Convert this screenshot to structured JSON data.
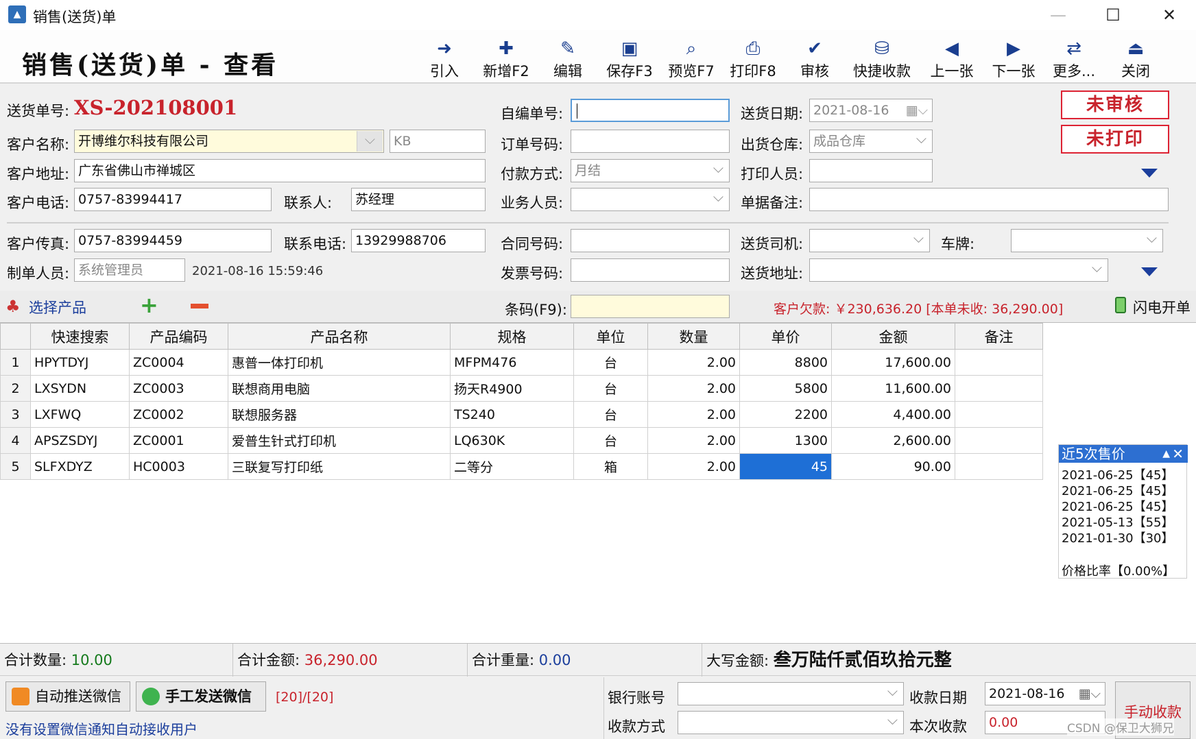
{
  "window": {
    "title": "销售(送货)单"
  },
  "header": {
    "title": "销售(送货)单 - 查看"
  },
  "toolbar": [
    {
      "label": "引入",
      "icon": "➜"
    },
    {
      "label": "新增F2",
      "icon": "✚"
    },
    {
      "label": "编辑",
      "icon": "✎"
    },
    {
      "label": "保存F3",
      "icon": "▣"
    },
    {
      "label": "预览F7",
      "icon": "⌕"
    },
    {
      "label": "打印F8",
      "icon": "⎙"
    },
    {
      "label": "审核",
      "icon": "✔"
    },
    {
      "label": "快捷收款",
      "icon": "⛁"
    },
    {
      "label": "上一张",
      "icon": "◀"
    },
    {
      "label": "下一张",
      "icon": "▶"
    },
    {
      "label": "更多...",
      "icon": "⇄"
    },
    {
      "label": "关闭",
      "icon": "⏏"
    }
  ],
  "form": {
    "order_no_label": "送货单号:",
    "order_no": "XS-202108001",
    "self_no_label": "自编单号:",
    "self_no": "",
    "date_label": "送货日期:",
    "date": "2021-08-16",
    "customer_label": "客户名称:",
    "customer": "开博维尔科技有限公司",
    "customer_code": "KB",
    "order_code_label": "订单号码:",
    "order_code": "",
    "warehouse_label": "出货仓库:",
    "warehouse": "成品仓库",
    "address_label": "客户地址:",
    "address": "广东省佛山市禅城区",
    "payment_label": "付款方式:",
    "payment": "月结",
    "printer_label": "打印人员:",
    "printer": "",
    "phone_label": "客户电话:",
    "phone": "0757-83994417",
    "contact_label": "联系人:",
    "contact": "苏经理",
    "salesman_label": "业务人员:",
    "salesman": "",
    "remark_label": "单据备注:",
    "remark": "",
    "fax_label": "客户传真:",
    "fax": "0757-83994459",
    "contact_phone_label": "联系电话:",
    "contact_phone": "13929988706",
    "contract_label": "合同号码:",
    "contract": "",
    "driver_label": "送货司机:",
    "driver": "",
    "plate_label": "车牌:",
    "plate": "",
    "maker_label": "制单人员:",
    "maker": "系统管理员",
    "maker_time": "2021-08-16 15:59:46",
    "invoice_label": "发票号码:",
    "invoice": "",
    "delivery_addr_label": "送货地址:",
    "delivery_addr": ""
  },
  "status": {
    "audit": "未审核",
    "print": "未打印"
  },
  "product_bar": {
    "select_label": "选择产品",
    "barcode_label": "条码(F9):",
    "barcode": "",
    "debt_text": "客户欠款: ￥230,636.20 [本单未收: 36,290.00]",
    "flash_label": "闪电开单"
  },
  "table": {
    "headers": [
      "",
      "快速搜索",
      "产品编码",
      "产品名称",
      "规格",
      "单位",
      "数量",
      "单价",
      "金额",
      "备注"
    ],
    "rows": [
      [
        "1",
        "HPYTDYJ",
        "ZC0004",
        "惠普一体打印机",
        "MFPM476",
        "台",
        "2.00",
        "8800",
        "17,600.00",
        ""
      ],
      [
        "2",
        "LXSYDN",
        "ZC0003",
        "联想商用电脑",
        "扬天R4900",
        "台",
        "2.00",
        "5800",
        "11,600.00",
        ""
      ],
      [
        "3",
        "LXFWQ",
        "ZC0002",
        "联想服务器",
        "TS240",
        "台",
        "2.00",
        "2200",
        "4,400.00",
        ""
      ],
      [
        "4",
        "APSZSDYJ",
        "ZC0001",
        "爱普生针式打印机",
        "LQ630K",
        "台",
        "2.00",
        "1300",
        "2,600.00",
        ""
      ],
      [
        "5",
        "SLFXDYZ",
        "HC0003",
        "三联复写打印纸",
        "二等分",
        "箱",
        "2.00",
        "45",
        "90.00",
        ""
      ]
    ]
  },
  "price_popup": {
    "title": "近5次售价",
    "lines": [
      "2021-06-25【45】",
      "2021-06-25【45】",
      "2021-06-25【45】",
      "2021-05-13【55】",
      "2021-01-30【30】"
    ],
    "ratio": "价格比率【0.00%】"
  },
  "totals": {
    "qty_label": "合计数量:",
    "qty": "10.00",
    "amount_label": "合计金额:",
    "amount": "36,290.00",
    "weight_label": "合计重量:",
    "weight": "0.00",
    "capital_label": "大写金额:",
    "capital": "叁万陆仟贰佰玖拾元整"
  },
  "bottom": {
    "auto_push": "自动推送微信",
    "manual_send": "手工发送微信",
    "count": "[20]/[20]",
    "notice": "没有设置微信通知自动接收用户",
    "bank_label": "银行账号",
    "bank": "",
    "receive_date_label": "收款日期",
    "receive_date": "2021-08-16",
    "receive_method_label": "收款方式",
    "receive_method": "",
    "this_receive_label": "本次收款",
    "this_receive": "0.00",
    "manual_receive": "手动收款",
    "watermark": "CSDN @保卫大狮兄"
  },
  "colors": {
    "accent": "#1e6fd6",
    "alert": "#c8232c",
    "ok": "#157a1c"
  }
}
